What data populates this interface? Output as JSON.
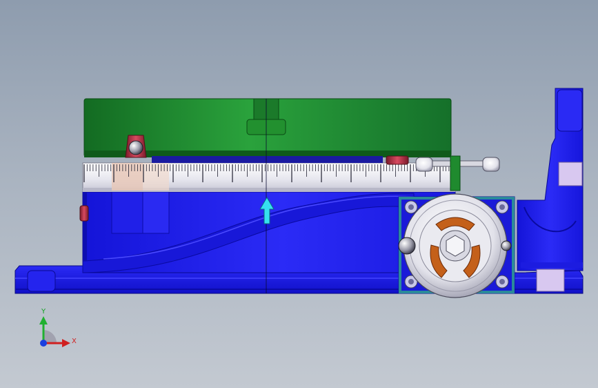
{
  "viewport": {
    "background_top": "#8e9cae",
    "background_bottom": "#c3c9d1"
  },
  "colors": {
    "base_blue": "#1a1ae6",
    "base_blue_dark": "#0a0a9a",
    "table_green": "#1f8a2e",
    "table_green_dark": "#0f5a1a",
    "dial_silver": "#e4e4ec",
    "clamp_red": "#b8334a",
    "teal_plate": "#2a8a9a",
    "bronze": "#c4601a",
    "cyan_arrow": "#35e0f0"
  },
  "icons": {
    "triad": "coordinate-triad-icon",
    "arrow": "cyan-up-arrow-icon"
  },
  "triad": {
    "x_label": "X",
    "y_label": "Y"
  }
}
